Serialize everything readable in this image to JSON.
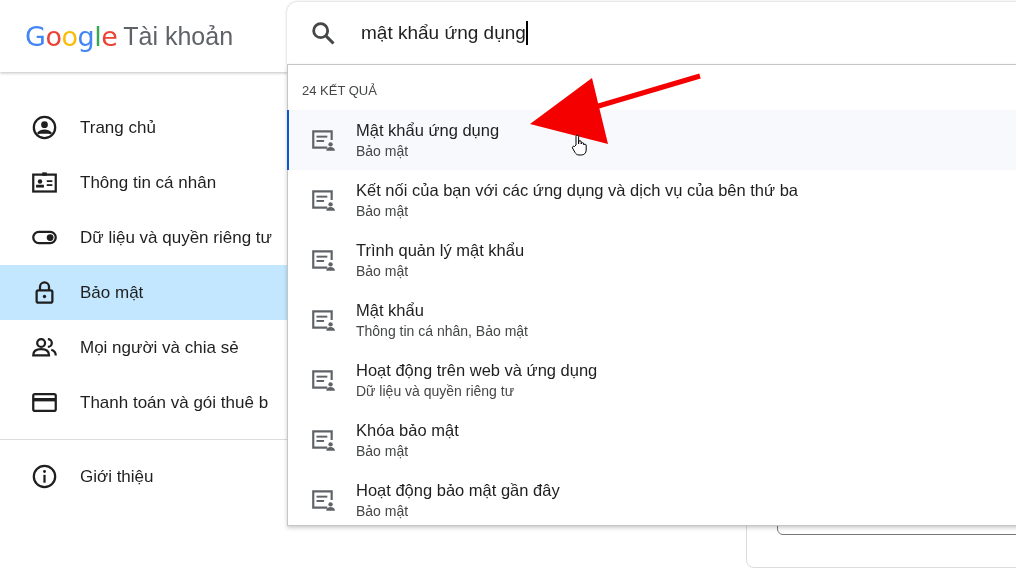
{
  "header": {
    "logo": "Google",
    "product": "Tài khoản"
  },
  "search": {
    "value": "mật khẩu ứng dụng"
  },
  "sidebar": {
    "items": [
      {
        "label": "Trang chủ",
        "kind": "home",
        "selected": false
      },
      {
        "label": "Thông tin cá nhân",
        "kind": "id",
        "selected": false
      },
      {
        "label": "Dữ liệu và quyền riêng tư",
        "kind": "toggle",
        "selected": false
      },
      {
        "label": "Bảo mật",
        "kind": "lock",
        "selected": true
      },
      {
        "label": "Mọi người và chia sẻ",
        "kind": "people",
        "selected": false
      },
      {
        "label": "Thanh toán và gói thuê b",
        "kind": "card",
        "selected": false
      }
    ],
    "footer_items": [
      {
        "label": "Giới thiệu",
        "kind": "info",
        "selected": false
      }
    ]
  },
  "results": {
    "count": "24 KẾT QUẢ",
    "items": [
      {
        "title": "Mật khẩu ứng dụng",
        "section": "Bảo mật",
        "selected": true
      },
      {
        "title": "Kết nối của bạn với các ứng dụng và dịch vụ của bên thứ ba",
        "section": "Bảo mật",
        "selected": false
      },
      {
        "title": "Trình quản lý mật khẩu",
        "section": "Bảo mật",
        "selected": false
      },
      {
        "title": "Mật khẩu",
        "section": "Thông tin cá nhân, Bảo mật",
        "selected": false
      },
      {
        "title": "Hoạt động trên web và ứng dụng",
        "section": "Dữ liệu và quyền riêng tư",
        "selected": false
      },
      {
        "title": "Khóa bảo mật",
        "section": "Bảo mật",
        "selected": false
      },
      {
        "title": "Hoạt động bảo mật gần đây",
        "section": "Bảo mật",
        "selected": false
      }
    ]
  }
}
